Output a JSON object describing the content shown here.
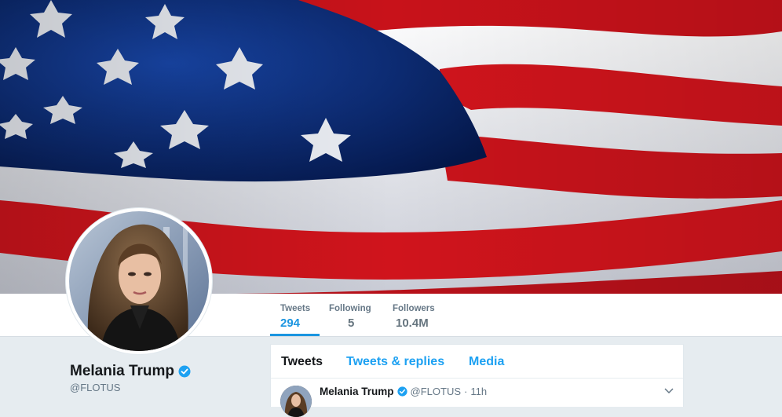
{
  "profile": {
    "name": "Melania Trump",
    "handle": "@FLOTUS",
    "verified": true
  },
  "stats": [
    {
      "label": "Tweets",
      "value": "294",
      "active": true
    },
    {
      "label": "Following",
      "value": "5",
      "active": false
    },
    {
      "label": "Followers",
      "value": "10.4M",
      "active": false
    }
  ],
  "tabs": [
    {
      "label": "Tweets",
      "active": true
    },
    {
      "label": "Tweets & replies",
      "active": false
    },
    {
      "label": "Media",
      "active": false
    }
  ],
  "tweet": {
    "name": "Melania Trump",
    "handle": "@FLOTUS",
    "separator": "·",
    "time": "11h"
  },
  "icons": {
    "verified": "verified-badge-icon",
    "caret": "chevron-down-icon"
  },
  "colors": {
    "accent": "#1da1f2",
    "flag_red": "#d0141c",
    "flag_blue": "#0b2d73",
    "page_bg": "#e6ecf0"
  }
}
